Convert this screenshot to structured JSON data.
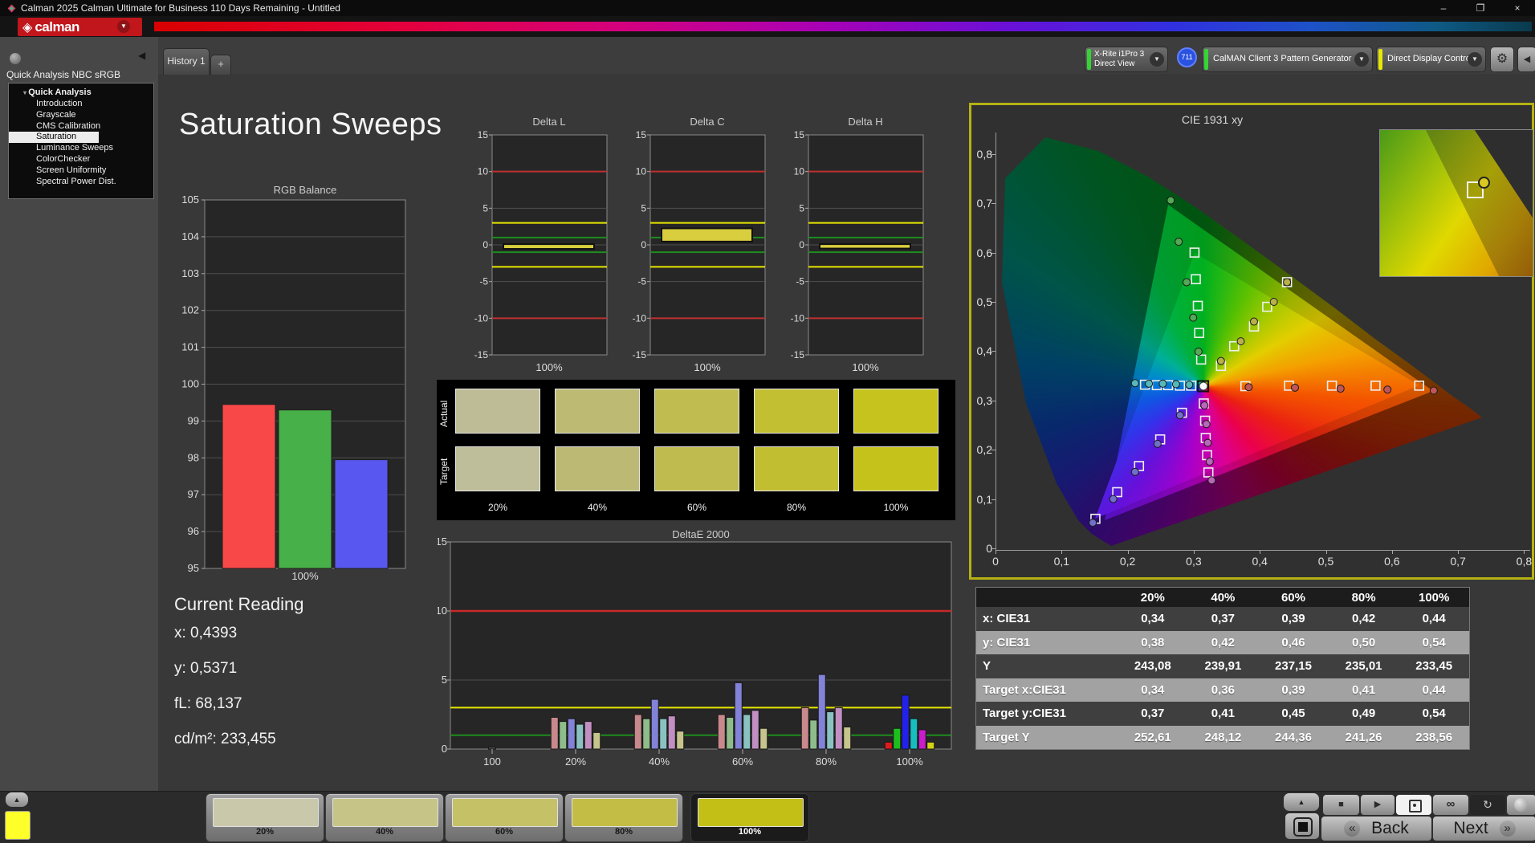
{
  "window": {
    "title": "Calman 2025 Calman Ultimate for Business 110 Days Remaining  - Untitled",
    "minimize": "–",
    "maximize": "❐",
    "close": "×"
  },
  "logo": {
    "text": "calman"
  },
  "icons": {
    "dropdown": "▼",
    "up": "▲",
    "left": "◀",
    "play": "▶",
    "stop": "■",
    "loop": "∞",
    "sync": "↻",
    "gear": "⚙",
    "add": "+",
    "back_chev": "«",
    "next_chev": "»",
    "collapse": "◀",
    "diamond": "◈"
  },
  "tabs": {
    "active": "History 1"
  },
  "devices": {
    "meter_line1": "X-Rite i1Pro 3",
    "meter_line2": "Direct View",
    "meter_badge": "711",
    "source": "CalMAN Client 3 Pattern Generator",
    "display": "Direct Display Control"
  },
  "sidebar": {
    "title": "Quick Analysis NBC sRGB",
    "root": "Quick Analysis",
    "items": [
      "Introduction",
      "Grayscale",
      "CMS Calibration",
      "Saturation Sweeps",
      "Luminance Sweeps",
      "ColorChecker",
      "Screen Uniformity",
      "Spectral Power Dist."
    ],
    "selected": "Saturation Sweeps"
  },
  "page_title": "Saturation Sweeps",
  "current_reading": {
    "title": "Current Reading",
    "lines": [
      "x: 0,4393",
      "y: 0,5371",
      "fL: 68,137",
      "cd/m²: 233,455"
    ]
  },
  "chart_data": [
    {
      "id": "rgb_balance",
      "type": "bar",
      "title": "RGB Balance",
      "xlabel": "100%",
      "ylim": [
        95,
        105
      ],
      "ytick_step": 1,
      "categories": [
        "red",
        "green",
        "blue"
      ],
      "values": [
        99.45,
        99.3,
        97.95
      ],
      "colors": [
        "#f84848",
        "#48b048",
        "#5858f0"
      ]
    },
    {
      "id": "delta_l",
      "type": "bar",
      "title": "Delta L",
      "xlabel": "100%",
      "ylim": [
        -15,
        15
      ],
      "yticks": [
        15,
        10,
        5,
        0,
        -5,
        -10,
        -15
      ],
      "bar_top": 0.1,
      "bar_bottom": -0.55,
      "limits": {
        "red": 10,
        "yellow": 3,
        "green": 1
      }
    },
    {
      "id": "delta_c",
      "type": "bar",
      "title": "Delta C",
      "xlabel": "100%",
      "ylim": [
        -15,
        15
      ],
      "yticks": [
        15,
        10,
        5,
        0,
        -5,
        -10,
        -15
      ],
      "bar_top": 2.25,
      "bar_bottom": 0.45,
      "limits": {
        "red": 10,
        "yellow": 3,
        "green": 1
      }
    },
    {
      "id": "delta_h",
      "type": "bar",
      "title": "Delta H",
      "xlabel": "100%",
      "ylim": [
        -15,
        15
      ],
      "yticks": [
        15,
        10,
        5,
        0,
        -5,
        -10,
        -15
      ],
      "bar_top": 0.1,
      "bar_bottom": -0.5,
      "limits": {
        "red": 10,
        "yellow": 3,
        "green": 1
      }
    },
    {
      "id": "deltae2000",
      "type": "bar",
      "title": "DeltaE 2000",
      "ylim": [
        0,
        15
      ],
      "yticks": [
        0,
        5,
        10,
        15
      ],
      "categories": [
        "100",
        "20%",
        "40%",
        "60%",
        "80%",
        "100%"
      ],
      "groups": [
        [
          0.15
        ],
        [
          2.3,
          2.0,
          2.2,
          1.8,
          2.0,
          1.2
        ],
        [
          2.5,
          2.2,
          3.6,
          2.2,
          2.4,
          1.3
        ],
        [
          2.5,
          2.3,
          4.8,
          2.5,
          2.8,
          1.5
        ],
        [
          3.0,
          2.1,
          5.4,
          2.7,
          3.0,
          1.6
        ],
        [
          0.5,
          1.5,
          3.9,
          2.2,
          1.4,
          0.5
        ]
      ],
      "colors_neutral": [
        "#4a4a4a"
      ],
      "colors_pastel": [
        "#c8898c",
        "#8ebc8a",
        "#8282d8",
        "#8ac2c2",
        "#c28fc2",
        "#c4c48c"
      ],
      "colors_vivid": [
        "#dd1c1c",
        "#1cc01c",
        "#2222ea",
        "#18bebe",
        "#ca1cca",
        "#d2d216"
      ],
      "limits": {
        "red": 10,
        "yellow": 3,
        "green": 1
      }
    },
    {
      "id": "cie",
      "type": "scatter",
      "title": "CIE 1931 xy",
      "xticks": [
        "0",
        "0,1",
        "0,2",
        "0,3",
        "0,4",
        "0,5",
        "0,6",
        "0,7",
        "0,8"
      ],
      "yticks": [
        "0",
        "0,1",
        "0,2",
        "0,3",
        "0,4",
        "0,5",
        "0,6",
        "0,7",
        "0,8"
      ],
      "white_point": {
        "x": 0.313,
        "y": 0.329
      },
      "gamut_native": [
        [
          0.661,
          0.319
        ],
        [
          0.26,
          0.697
        ],
        [
          0.164,
          0.057
        ]
      ],
      "gamut_reference": [
        [
          0.64,
          0.33
        ],
        [
          0.3,
          0.6
        ],
        [
          0.15,
          0.06
        ]
      ],
      "sweeps": [
        {
          "name": "red",
          "color": "#c05555",
          "target": [
            [
              0.377,
              0.329
            ],
            [
              0.443,
              0.33
            ],
            [
              0.508,
              0.33
            ],
            [
              0.574,
              0.33
            ],
            [
              0.64,
              0.33
            ]
          ],
          "measured": [
            [
              0.382,
              0.327
            ],
            [
              0.452,
              0.326
            ],
            [
              0.521,
              0.324
            ],
            [
              0.592,
              0.322
            ],
            [
              0.662,
              0.32
            ]
          ]
        },
        {
          "name": "green",
          "color": "#55a855",
          "target": [
            [
              0.31,
              0.383
            ],
            [
              0.307,
              0.437
            ],
            [
              0.305,
              0.492
            ],
            [
              0.302,
              0.546
            ],
            [
              0.3,
              0.6
            ]
          ],
          "measured": [
            [
              0.306,
              0.399
            ],
            [
              0.298,
              0.468
            ],
            [
              0.288,
              0.54
            ],
            [
              0.276,
              0.622
            ],
            [
              0.264,
              0.706
            ]
          ]
        },
        {
          "name": "blue",
          "color": "#7070c8",
          "target": [
            [
              0.281,
              0.275
            ],
            [
              0.248,
              0.221
            ],
            [
              0.216,
              0.167
            ],
            [
              0.183,
              0.114
            ],
            [
              0.15,
              0.06
            ]
          ],
          "measured": [
            [
              0.278,
              0.27
            ],
            [
              0.244,
              0.212
            ],
            [
              0.21,
              0.155
            ],
            [
              0.177,
              0.1
            ],
            [
              0.146,
              0.052
            ]
          ]
        },
        {
          "name": "cyan",
          "color": "#58b8b8",
          "target": [
            [
              0.295,
              0.33
            ],
            [
              0.278,
              0.33
            ],
            [
              0.26,
              0.331
            ],
            [
              0.243,
              0.331
            ],
            [
              0.225,
              0.332
            ]
          ],
          "measured": [
            [
              0.292,
              0.332
            ],
            [
              0.272,
              0.333
            ],
            [
              0.252,
              0.334
            ],
            [
              0.231,
              0.334
            ],
            [
              0.21,
              0.335
            ]
          ]
        },
        {
          "name": "magenta",
          "color": "#b868b8",
          "target": [
            [
              0.314,
              0.294
            ],
            [
              0.316,
              0.259
            ],
            [
              0.317,
              0.224
            ],
            [
              0.319,
              0.189
            ],
            [
              0.321,
              0.154
            ]
          ],
          "measured": [
            [
              0.315,
              0.29
            ],
            [
              0.318,
              0.252
            ],
            [
              0.32,
              0.214
            ],
            [
              0.323,
              0.176
            ],
            [
              0.326,
              0.138
            ]
          ]
        },
        {
          "name": "yellow",
          "color": "#b8b048",
          "target": [
            [
              0.34,
              0.37
            ],
            [
              0.36,
              0.41
            ],
            [
              0.39,
              0.45
            ],
            [
              0.41,
              0.49
            ],
            [
              0.44,
              0.54
            ]
          ],
          "measured": [
            [
              0.34,
              0.38
            ],
            [
              0.37,
              0.42
            ],
            [
              0.39,
              0.46
            ],
            [
              0.42,
              0.5
            ],
            [
              0.44,
              0.54
            ]
          ]
        }
      ]
    },
    {
      "id": "results_table",
      "type": "table",
      "columns": [
        "20%",
        "40%",
        "60%",
        "80%",
        "100%"
      ],
      "rows": [
        {
          "label": "x: CIE31",
          "values": [
            "0,34",
            "0,37",
            "0,39",
            "0,42",
            "0,44"
          ]
        },
        {
          "label": "y: CIE31",
          "values": [
            "0,38",
            "0,42",
            "0,46",
            "0,50",
            "0,54"
          ]
        },
        {
          "label": "Y",
          "values": [
            "243,08",
            "239,91",
            "237,15",
            "235,01",
            "233,45"
          ]
        },
        {
          "label": "Target x:CIE31",
          "values": [
            "0,34",
            "0,36",
            "0,39",
            "0,41",
            "0,44"
          ]
        },
        {
          "label": "Target y:CIE31",
          "values": [
            "0,37",
            "0,41",
            "0,45",
            "0,49",
            "0,54"
          ]
        },
        {
          "label": "Target Y",
          "values": [
            "252,61",
            "248,12",
            "244,36",
            "241,26",
            "238,56"
          ]
        }
      ]
    }
  ],
  "swatch_panel": {
    "row_labels": [
      "Actual",
      "Target"
    ],
    "col_labels": [
      "20%",
      "40%",
      "60%",
      "80%",
      "100%"
    ],
    "actual_colors": [
      "#bdbc97",
      "#bdba74",
      "#c0bc50",
      "#c3bf33",
      "#c6c31e"
    ],
    "target_colors": [
      "#bfbe9a",
      "#bcb975",
      "#bfbb4f",
      "#c2be31",
      "#c5c21c"
    ]
  },
  "bottom_bar": {
    "patches": [
      {
        "label": "20%",
        "color": "#c9c8ab",
        "selected": false
      },
      {
        "label": "40%",
        "color": "#c7c487",
        "selected": false
      },
      {
        "label": "60%",
        "color": "#c5c167",
        "selected": false
      },
      {
        "label": "80%",
        "color": "#c3bd45",
        "selected": false
      },
      {
        "label": "100%",
        "color": "#c3bf17",
        "selected": true
      }
    ],
    "preview_color": "#ffff29",
    "transport": {
      "back": "Back",
      "next": "Next"
    }
  }
}
